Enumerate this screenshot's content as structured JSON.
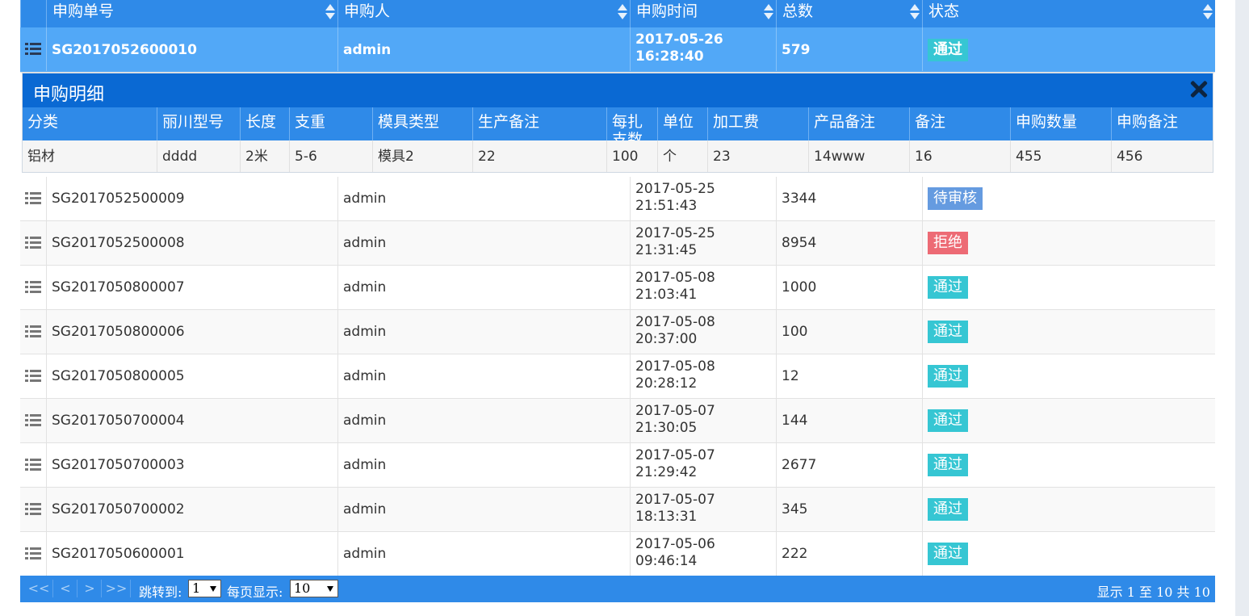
{
  "columns": {
    "order_no": "申购单号",
    "applicant": "申购人",
    "time": "申购时间",
    "total": "总数",
    "status": "状态"
  },
  "selected_row": {
    "order_no": "SG2017052600010",
    "applicant": "admin",
    "date": "2017-05-26",
    "clock": "16:28:40",
    "total": "579",
    "status": "通过"
  },
  "detail": {
    "title": "申购明细",
    "headers": [
      "分类",
      "丽川型号",
      "长度",
      "支重",
      "模具类型",
      "生产备注",
      "每扎支数",
      "单位",
      "加工费",
      "产品备注",
      "备注",
      "申购数量",
      "申购备注"
    ],
    "row": [
      "铝材",
      "dddd",
      "2米",
      "5-6",
      "模具2",
      "22",
      "100",
      "个",
      "23",
      "14www",
      "16",
      "455",
      "456"
    ]
  },
  "rows": [
    {
      "order_no": "SG2017052500009",
      "applicant": "admin",
      "date": "2017-05-25",
      "clock": "21:51:43",
      "total": "3344",
      "status": "待审核"
    },
    {
      "order_no": "SG2017052500008",
      "applicant": "admin",
      "date": "2017-05-25",
      "clock": "21:31:45",
      "total": "8954",
      "status": "拒绝"
    },
    {
      "order_no": "SG2017050800007",
      "applicant": "admin",
      "date": "2017-05-08",
      "clock": "21:03:41",
      "total": "1000",
      "status": "通过"
    },
    {
      "order_no": "SG2017050800006",
      "applicant": "admin",
      "date": "2017-05-08",
      "clock": "20:37:00",
      "total": "100",
      "status": "通过"
    },
    {
      "order_no": "SG2017050800005",
      "applicant": "admin",
      "date": "2017-05-08",
      "clock": "20:28:12",
      "total": "12",
      "status": "通过"
    },
    {
      "order_no": "SG2017050700004",
      "applicant": "admin",
      "date": "2017-05-07",
      "clock": "21:30:05",
      "total": "144",
      "status": "通过"
    },
    {
      "order_no": "SG2017050700003",
      "applicant": "admin",
      "date": "2017-05-07",
      "clock": "21:29:42",
      "total": "2677",
      "status": "通过"
    },
    {
      "order_no": "SG2017050700002",
      "applicant": "admin",
      "date": "2017-05-07",
      "clock": "18:13:31",
      "total": "345",
      "status": "通过"
    },
    {
      "order_no": "SG2017050600001",
      "applicant": "admin",
      "date": "2017-05-06",
      "clock": "09:46:14",
      "total": "222",
      "status": "通过"
    }
  ],
  "status_colors": {
    "通过": "#36c6d3",
    "待审核": "#659be0",
    "拒绝": "#ed6b75"
  },
  "footer": {
    "first": "<<",
    "prev": "<",
    "next": ">",
    "last": ">>",
    "jump_label": "跳转到:",
    "jump_value": "1",
    "per_page_label": "每页显示:",
    "per_page_value": "10",
    "summary": "显示 1 至 10 共 10"
  },
  "icons": {
    "row_menu": "list-icon",
    "close": "close-icon",
    "sort": "sort-icon",
    "dropdown": "caret-down-icon"
  }
}
